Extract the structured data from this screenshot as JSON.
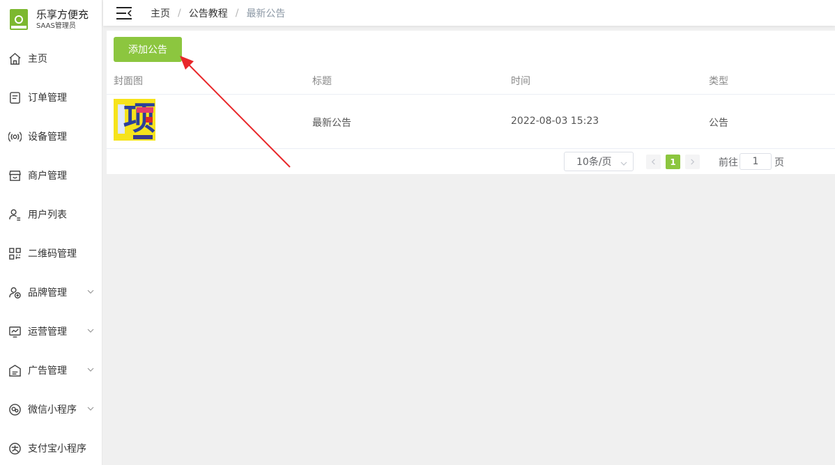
{
  "brand": {
    "name": "乐享方便充",
    "subtitle": "SAAS管理员",
    "logo_color": "#7cb82f"
  },
  "sidebar": {
    "items": [
      {
        "label": "主页",
        "icon": "home-icon",
        "expandable": false
      },
      {
        "label": "订单管理",
        "icon": "order-icon",
        "expandable": false
      },
      {
        "label": "设备管理",
        "icon": "device-icon",
        "expandable": false
      },
      {
        "label": "商户管理",
        "icon": "store-icon",
        "expandable": false
      },
      {
        "label": "用户列表",
        "icon": "user-list-icon",
        "expandable": false
      },
      {
        "label": "二维码管理",
        "icon": "qrcode-icon",
        "expandable": false
      },
      {
        "label": "品牌管理",
        "icon": "brand-icon",
        "expandable": true
      },
      {
        "label": "运营管理",
        "icon": "operations-icon",
        "expandable": true
      },
      {
        "label": "广告管理",
        "icon": "ad-icon",
        "expandable": true
      },
      {
        "label": "微信小程序",
        "icon": "wechat-icon",
        "expandable": true
      },
      {
        "label": "支付宝小程序",
        "icon": "alipay-icon",
        "expandable": false
      }
    ]
  },
  "header": {
    "breadcrumb": [
      "主页",
      "公告教程",
      "最新公告"
    ]
  },
  "toolbar": {
    "add_label": "添加公告"
  },
  "table": {
    "columns": [
      "封面图",
      "标题",
      "时间",
      "类型"
    ],
    "rows": [
      {
        "title": "最新公告",
        "time": "2022-08-03 15:23",
        "type": "公告"
      }
    ]
  },
  "pagination": {
    "page_size": "10条/页",
    "current_page": "1",
    "goto_label": "前往",
    "goto_value": "1",
    "goto_suffix": "页"
  },
  "colors": {
    "accent": "#8cc63f",
    "annotation_arrow": "#e8282b"
  }
}
